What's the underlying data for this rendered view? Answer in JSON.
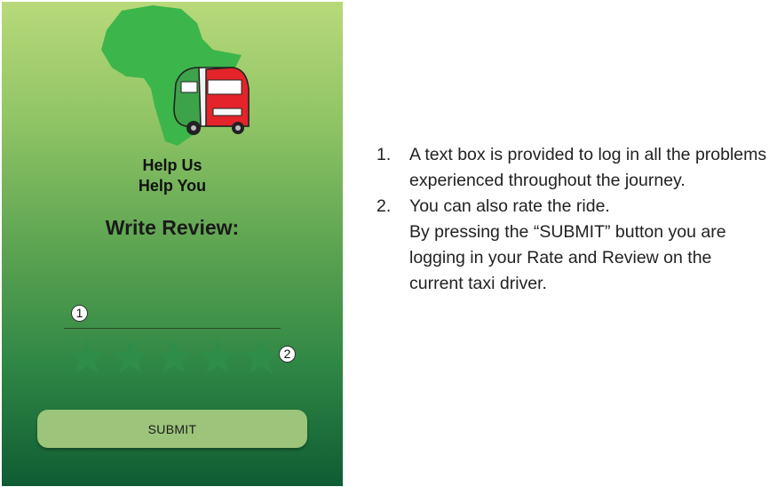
{
  "app": {
    "tagline_line1": "Help Us",
    "tagline_line2": "Help You",
    "title": "Write Review:",
    "review_input": {
      "value": "",
      "placeholder": ""
    },
    "rating": {
      "max": 5,
      "value": 0
    },
    "submit_label": "SUBMIT",
    "colors": {
      "background_top": "#b8d97a",
      "background_bottom": "#0f5c33",
      "star_empty": "#2f8d4a",
      "button": "#9cc47a",
      "africa": "#3cb54a",
      "taxi_red": "#e4242a"
    },
    "logo_icons": [
      "africa-map-icon",
      "taxi-van-icon"
    ]
  },
  "markers": {
    "m1": "1",
    "m2": "2"
  },
  "notes": [
    {
      "num": "1.",
      "lines": [
        "A text box is provided to log in all the problems experienced throughout the journey."
      ]
    },
    {
      "num": "2.",
      "lines": [
        "You can also rate the ride.",
        "By pressing the “SUBMIT” button you are logging in your Rate and Review on the current taxi driver."
      ]
    }
  ]
}
